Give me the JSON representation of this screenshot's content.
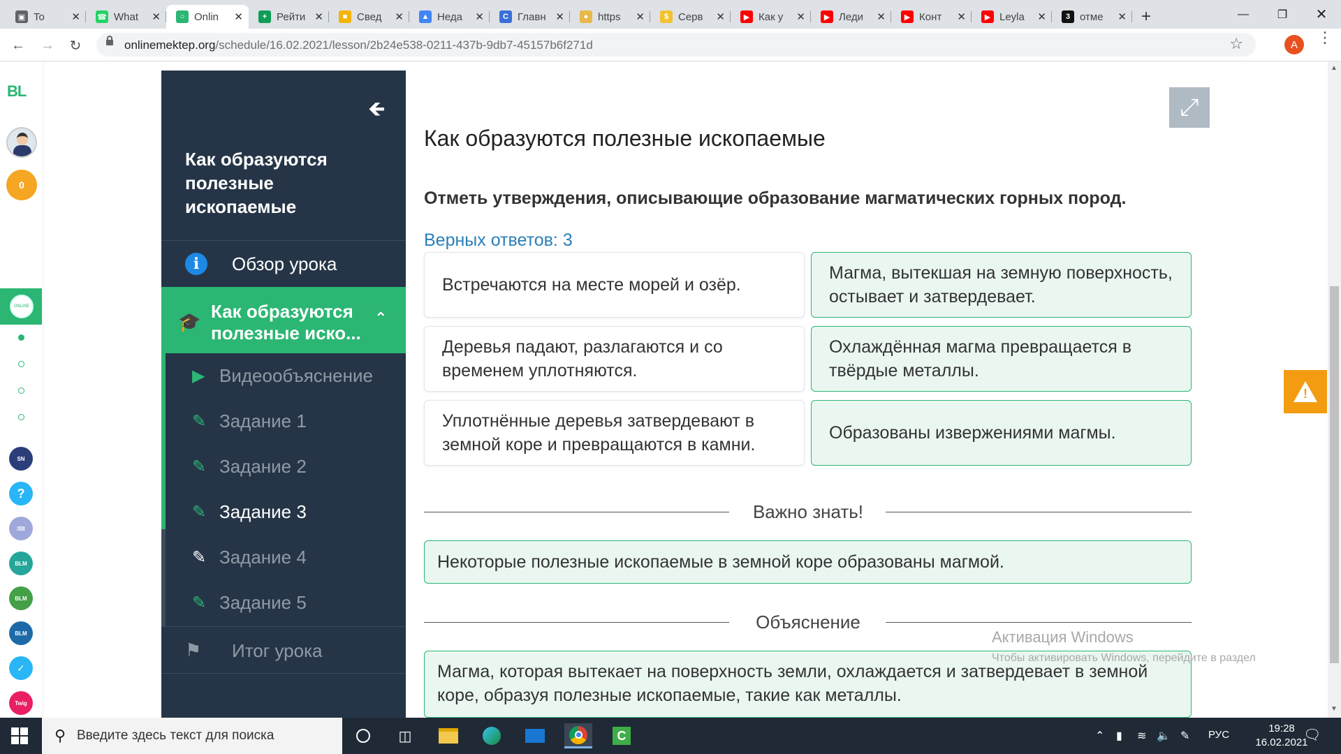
{
  "browser": {
    "tabs": [
      {
        "title": "To",
        "icon": "tab-icon",
        "color": "#5f6368"
      },
      {
        "title": "What",
        "icon": "whatsapp-icon",
        "color": "#25d366"
      },
      {
        "title": "Onlin",
        "icon": "onlinemektep-icon",
        "color": "#2bb673",
        "active": true
      },
      {
        "title": "Рейти",
        "icon": "sheets-icon",
        "color": "#0f9d58"
      },
      {
        "title": "Свед",
        "icon": "slides-icon",
        "color": "#f4b400"
      },
      {
        "title": "Неда",
        "icon": "drive-icon",
        "color": "#4285f4"
      },
      {
        "title": "Главн",
        "icon": "c-icon",
        "color": "#3b6fd8"
      },
      {
        "title": "https",
        "icon": "coin-icon",
        "color": "#e8b84a"
      },
      {
        "title": "Серв",
        "icon": "dollar-icon",
        "color": "#f2c230"
      },
      {
        "title": "Как у",
        "icon": "youtube-icon",
        "color": "#ff0000"
      },
      {
        "title": "Леди",
        "icon": "youtube-icon",
        "color": "#ff0000"
      },
      {
        "title": "Конт",
        "icon": "youtube-icon",
        "color": "#ff0000"
      },
      {
        "title": "Leyla",
        "icon": "youtube-icon",
        "color": "#ff0000"
      },
      {
        "title": "отме",
        "icon": "z-icon",
        "color": "#111111"
      }
    ],
    "url_host": "onlinemektep.org",
    "url_path": "/schedule/16.02.2021/lesson/2b24e538-0211-437b-9db7-45157b6f271d",
    "profile_letter": "A"
  },
  "rail": {
    "logo": "BL",
    "coins": "0"
  },
  "sidebar": {
    "lesson_title": "Как образуются полезные ископаемые",
    "overview_label": "Обзор урока",
    "current_section_label": "Как образуются полезные иско...",
    "sub_items": [
      {
        "label": "Видеообъяснение",
        "icon": "play-icon"
      },
      {
        "label": "Задание 1",
        "icon": "edit-icon"
      },
      {
        "label": "Задание 2",
        "icon": "edit-icon"
      },
      {
        "label": "Задание 3",
        "icon": "edit-icon"
      },
      {
        "label": "Задание 4",
        "icon": "edit-icon"
      },
      {
        "label": "Задание 5",
        "icon": "edit-icon"
      }
    ],
    "summary_label": "Итог урока"
  },
  "content": {
    "title": "Как образуются полезные ископаемые",
    "question": "Отметь утверждения, описывающие образование магматических горных пород.",
    "correct_count": "Верных ответов: 3",
    "options": [
      {
        "text": "Встречаются на месте морей и озёр.",
        "selected": false
      },
      {
        "text": "Магма, вытекшая на земную поверхность, остывает и затвердевает.",
        "selected": true
      },
      {
        "text": "Деревья падают, разлагаются и со временем уплотняются.",
        "selected": false
      },
      {
        "text": "Охлаждённая магма превращается в твёрдые металлы.",
        "selected": true
      },
      {
        "text": "Уплотнённые деревья затвердевают в земной коре и превращаются в камни.",
        "selected": false
      },
      {
        "text": "Образованы извержениями магмы.",
        "selected": true
      }
    ],
    "important_heading": "Важно знать!",
    "important_text": "Некоторые полезные ископаемые в земной коре образованы магмой.",
    "explanation_heading": "Объяснение",
    "explanation_text": "Магма, которая вытекает на поверхность земли, охлаждается и затвердевает в земной коре, образуя полезные ископаемые, такие как металлы."
  },
  "watermark": {
    "title": "Активация Windows",
    "subtitle": "Чтобы активировать Windows, перейдите в раздел"
  },
  "taskbar": {
    "search_placeholder": "Введите здесь текст для поиска",
    "language": "РУС",
    "time": "19:28",
    "date": "16.02.2021"
  },
  "colors": {
    "accent_green": "#2bb673",
    "sidebar_bg": "#253547",
    "link_blue": "#2a7fb8",
    "warning": "#f39c12"
  }
}
